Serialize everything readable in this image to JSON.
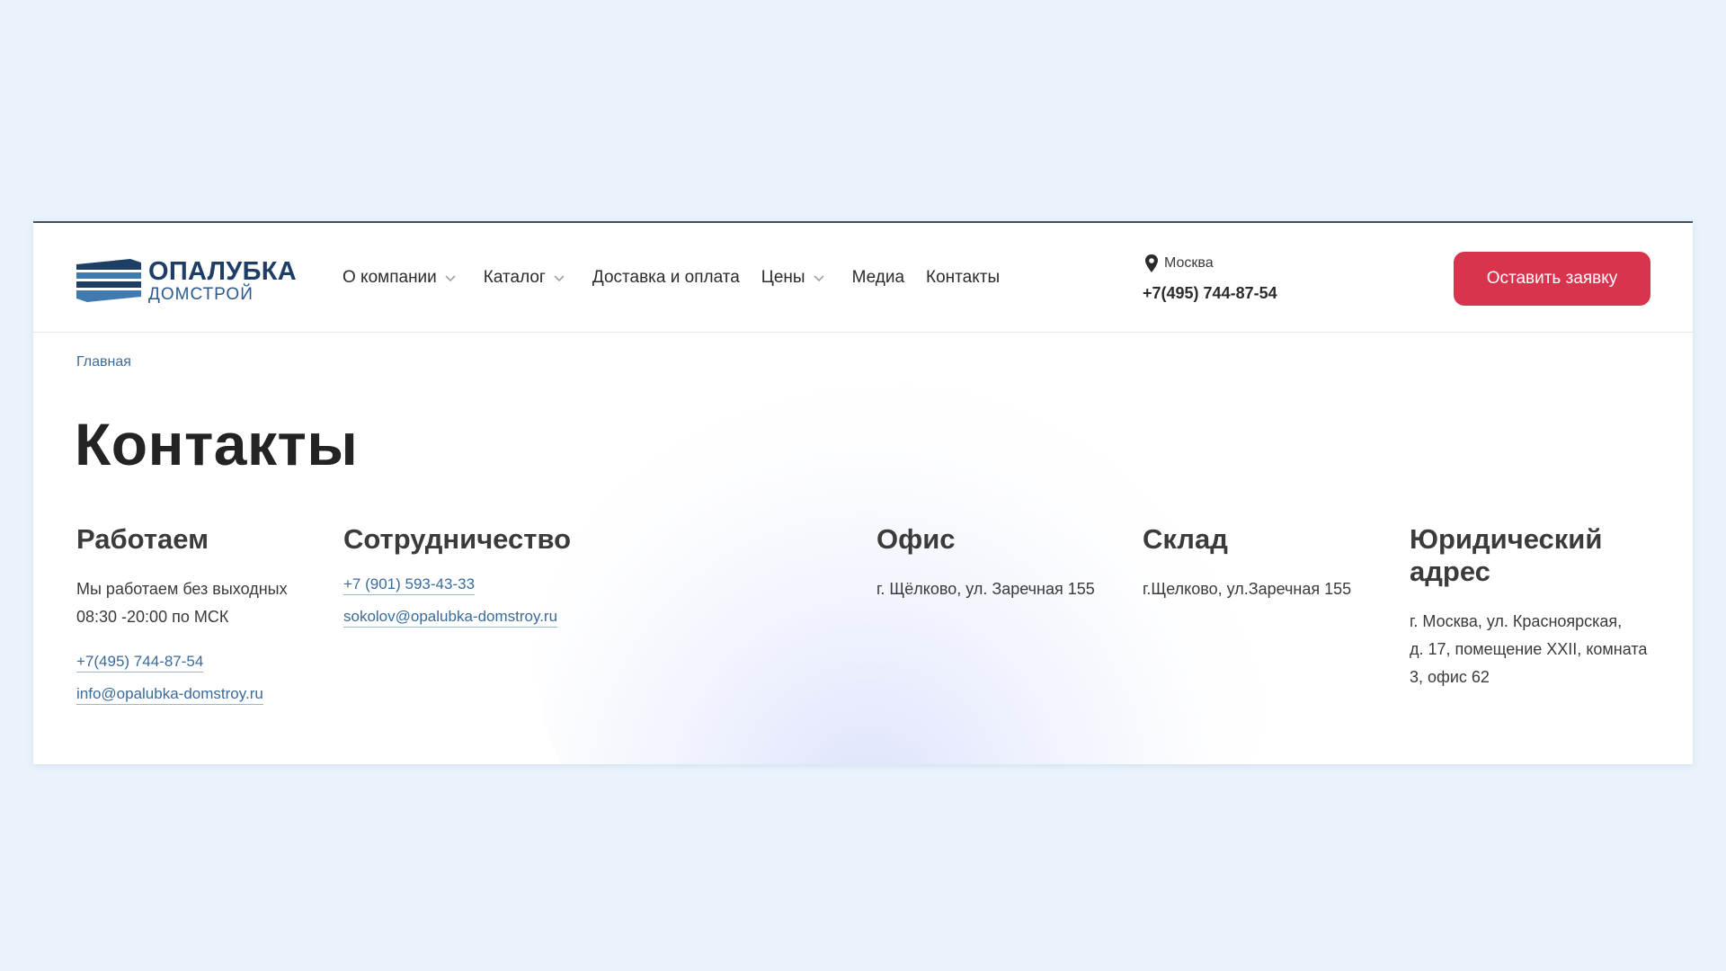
{
  "logo": {
    "main": "ОПАЛУБКА",
    "sub": "ДОМСТРОЙ",
    "mark_colors": [
      "#1f3e66",
      "#3f7ab0"
    ]
  },
  "nav": {
    "items": [
      {
        "label": "О компании",
        "has_dropdown": true
      },
      {
        "label": "Каталог",
        "has_dropdown": true
      },
      {
        "label": "Доставка и оплата",
        "has_dropdown": false
      },
      {
        "label": "Цены",
        "has_dropdown": true
      },
      {
        "label": "Медиа",
        "has_dropdown": false
      },
      {
        "label": "Контакты",
        "has_dropdown": false
      }
    ]
  },
  "header": {
    "city": "Москва",
    "phone": "+7(495) 744-87-54",
    "cta_label": "Оставить заявку"
  },
  "breadcrumb": {
    "home": "Главная"
  },
  "page": {
    "title": "Контакты"
  },
  "sections": {
    "work": {
      "title": "Работаем",
      "lines": [
        "Мы работаем без выходных",
        "08:30 -20:00 по МСК"
      ],
      "phone": "+7(495) 744-87-54",
      "email": "info@opalubka-domstroy.ru"
    },
    "partnership": {
      "title": "Сотрудничество",
      "phone": "+7 (901) 593-43-33",
      "email": "sokolov@opalubka-domstroy.ru"
    },
    "office": {
      "title": "Офис",
      "address": "г. Щёлково, ул. Заречная 155"
    },
    "warehouse": {
      "title": "Склад",
      "address": "г.Щелково, ул.Заречная 155"
    },
    "legal": {
      "title_lines": [
        "Юридический",
        "адрес"
      ],
      "address_lines": [
        "г. Москва, ул. Красноярская,",
        "д. 17, помещение XXII, комната",
        "3, офис 62"
      ]
    }
  },
  "colors": {
    "accent": "#d9344e",
    "link": "#3b6b9a",
    "brand": "#1f3e66",
    "page_bg": "#e9f3fc"
  }
}
